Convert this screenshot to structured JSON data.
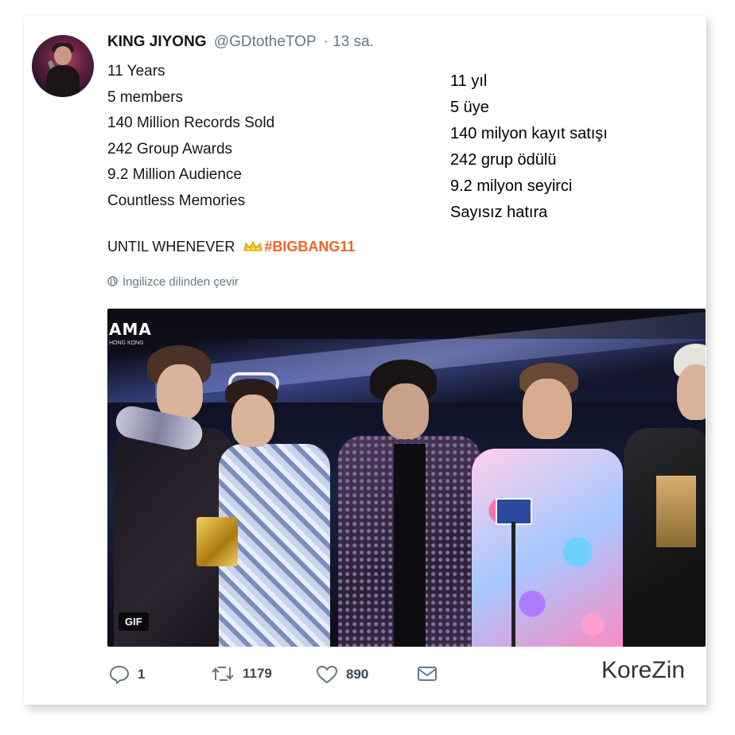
{
  "tweet": {
    "author_name": "KING JIYONG",
    "author_handle": "@GDtotheTOP",
    "time": "· 13 sa.",
    "lines": [
      "11 Years",
      "5 members",
      "140 Million Records Sold",
      "242 Group Awards",
      "9.2 Million Audience",
      "Countless Memories"
    ],
    "until_text": "UNTIL WHENEVER",
    "crown_icon": "crown-emoji-icon",
    "hashtag": "#BIGBANG11",
    "hashtag_color": "#f26522",
    "translate_label": "İngilizce dilinden çevir"
  },
  "translation": {
    "lines": [
      "11 yıl",
      "5 üye",
      "140 milyon kayıt satışı",
      "242 grup ödülü",
      "9.2 milyon seyirci",
      "Sayısız hatıra"
    ]
  },
  "media": {
    "logo_text": "AMA",
    "logo_sub": "HONG KONG",
    "gif_badge": "GIF"
  },
  "actions": {
    "reply_count": "1",
    "retweet_count": "1179",
    "like_count": "890"
  },
  "watermark": "KoreZin"
}
